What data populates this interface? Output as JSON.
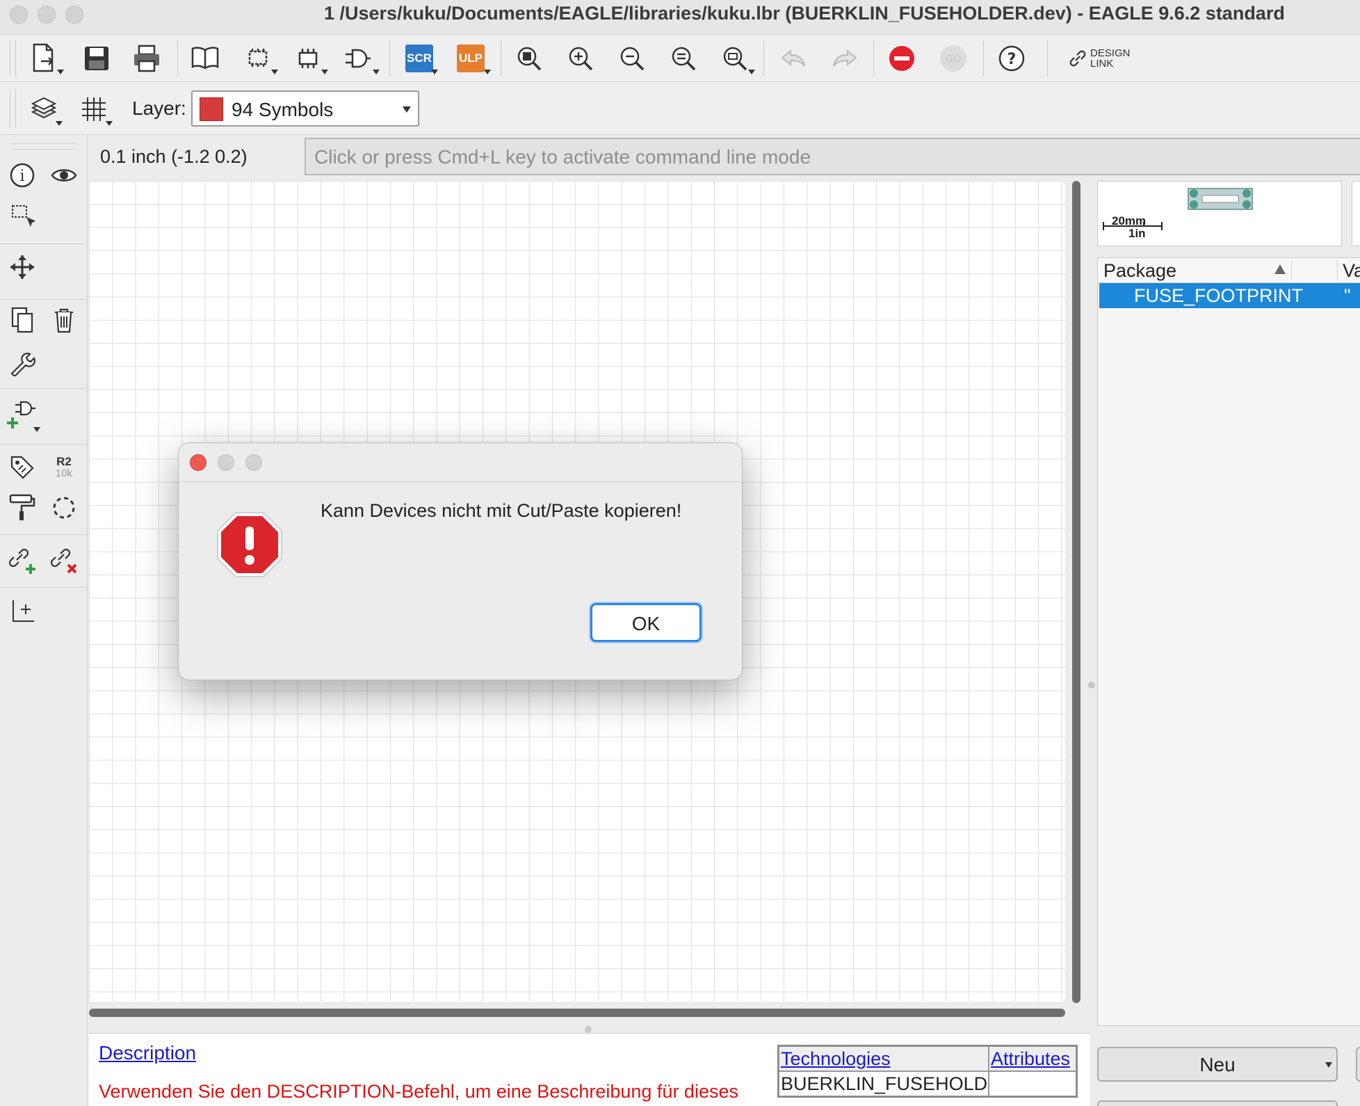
{
  "window": {
    "title": "1 /Users/kuku/Documents/EAGLE/libraries/kuku.lbr (BUERKLIN_FUSEHOLDER.dev) - EAGLE 9.6.2 standard"
  },
  "toolbar": {
    "design_link_label_1": "DESIGN",
    "design_link_label_2": "LINK",
    "scr_label": "SCR",
    "ulp_label": "ULP",
    "go_label": "GO",
    "layer_label": "Layer:",
    "layer_value": "94 Symbols",
    "layer_color": "#d63b3b"
  },
  "left_tools": {
    "r2_label": "R2",
    "r2_value": "10k"
  },
  "command": {
    "coordinates": "0.1 inch (-1.2 0.2)",
    "placeholder": "Click or press Cmd+L key to activate command line mode"
  },
  "preview": {
    "scale_mm": "20mm",
    "scale_in": "1in"
  },
  "package_list": {
    "col_package": "Package",
    "col_value": "Va",
    "rows": [
      {
        "name": "FUSE_FOOTPRINT",
        "value": "\""
      }
    ]
  },
  "right_buttons": {
    "new_label": "Neu"
  },
  "description": {
    "link": "Description",
    "text": "Verwenden Sie den DESCRIPTION-Befehl, um eine Beschreibung für dieses"
  },
  "technologies": {
    "col_tech": "Technologies",
    "col_attr": "Attributes",
    "rows": [
      {
        "tech": "BUERKLIN_FUSEHOLDER",
        "attr": ""
      }
    ]
  },
  "dialog": {
    "message": "Kann Devices nicht mit Cut/Paste kopieren!",
    "ok_label": "OK",
    "icon": "stop-alert-icon"
  },
  "colors": {
    "selection": "#1e88d8",
    "link": "#1a1ad0",
    "warning_text": "#e01010",
    "alert_red": "#d9252b",
    "focus_ring": "#2b85e0"
  }
}
